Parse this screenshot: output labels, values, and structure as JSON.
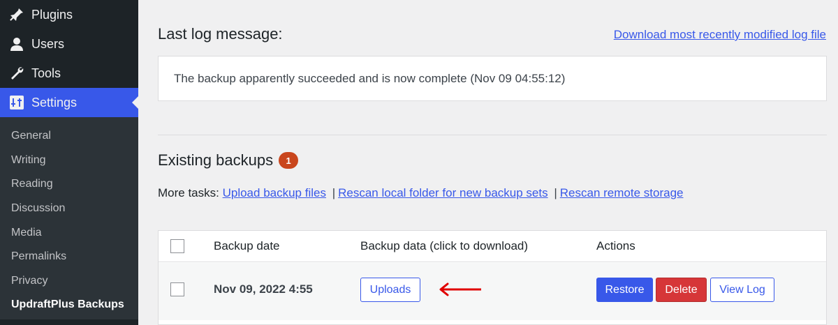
{
  "sidebar": {
    "menu": [
      {
        "label": "Plugins",
        "icon": "plugin-icon"
      },
      {
        "label": "Users",
        "icon": "user-icon"
      },
      {
        "label": "Tools",
        "icon": "wrench-icon"
      },
      {
        "label": "Settings",
        "icon": "settings-icon"
      }
    ],
    "submenu": [
      "General",
      "Writing",
      "Reading",
      "Discussion",
      "Media",
      "Permalinks",
      "Privacy",
      "UpdraftPlus Backups"
    ]
  },
  "log": {
    "title": "Last log message:",
    "download_link": "Download most recently modified log file",
    "message": "The backup apparently succeeded and is now complete (Nov 09 04:55:12)"
  },
  "backups": {
    "title": "Existing backups",
    "badge": "1",
    "tasks_label": "More tasks:",
    "tasks": [
      "Upload backup files",
      "Rescan local folder for new backup sets",
      "Rescan remote storage"
    ],
    "separator": "|",
    "columns": [
      "Backup date",
      "Backup data (click to download)",
      "Actions"
    ],
    "rows": [
      {
        "date": "Nov 09, 2022 4:55",
        "data_button": "Uploads",
        "actions": [
          "Restore",
          "Delete",
          "View Log"
        ]
      }
    ]
  },
  "colors": {
    "accent": "#3858e9",
    "danger": "#d63638",
    "badge": "#c9461d",
    "sidebar": "#1d2327"
  }
}
